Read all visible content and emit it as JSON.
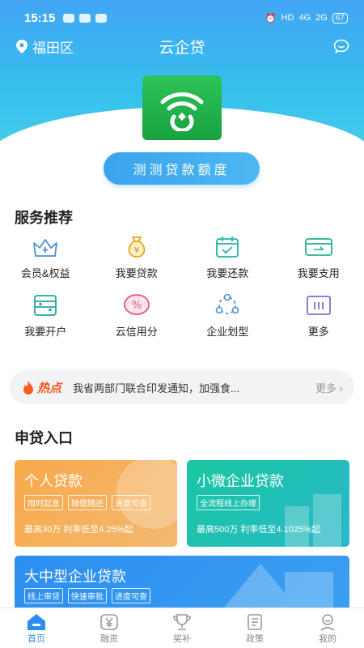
{
  "status_bar": {
    "time": "15:15",
    "network": "HD",
    "signal_4g": "4G",
    "signal_2g": "2G",
    "battery": "67"
  },
  "nav": {
    "location": "福田区",
    "title": "云企贷"
  },
  "hero": {
    "cta_label": "测测贷款额度"
  },
  "services": {
    "title": "服务推荐",
    "items": [
      {
        "label": "会员&权益",
        "icon": "crown-icon"
      },
      {
        "label": "我要贷款",
        "icon": "money-bag-icon"
      },
      {
        "label": "我要还款",
        "icon": "calendar-check-icon"
      },
      {
        "label": "我要支用",
        "icon": "card-transfer-icon"
      },
      {
        "label": "我要开户",
        "icon": "account-icon"
      },
      {
        "label": "云信用分",
        "icon": "percent-icon"
      },
      {
        "label": "企业划型",
        "icon": "network-icon"
      },
      {
        "label": "更多",
        "icon": "more-icon"
      }
    ]
  },
  "news": {
    "hot_label": "热点",
    "text": "我省两部门联合印发通知，加强食...",
    "more_label": "更多"
  },
  "loan_entry": {
    "title": "申贷入口",
    "cards": [
      {
        "title": "个人贷款",
        "tags": [
          "用时起息",
          "随借随还",
          "进度可查"
        ],
        "desc": "最高30万 利率低至4.25%起",
        "color": "#f9a94b"
      },
      {
        "title": "小微企业贷款",
        "tags": [
          "全流程线上办理"
        ],
        "desc": "最高500万 利率低至4.1025%起",
        "color": "#19c7a1"
      },
      {
        "title": "大中型企业贷款",
        "tags": [
          "线上审贷",
          "快速审批",
          "进度可查"
        ],
        "desc": "",
        "color": "#2d8ef0"
      }
    ]
  },
  "tabbar": {
    "items": [
      {
        "label": "首页",
        "icon": "home-icon",
        "active": true
      },
      {
        "label": "融资",
        "icon": "yuan-icon",
        "active": false
      },
      {
        "label": "奖补",
        "icon": "trophy-icon",
        "active": false
      },
      {
        "label": "政策",
        "icon": "document-icon",
        "active": false
      },
      {
        "label": "我的",
        "icon": "user-icon",
        "active": false
      }
    ]
  },
  "colors": {
    "primary": "#2d8ef0",
    "hot": "#ff5722",
    "logo_green": "#1fae47"
  }
}
